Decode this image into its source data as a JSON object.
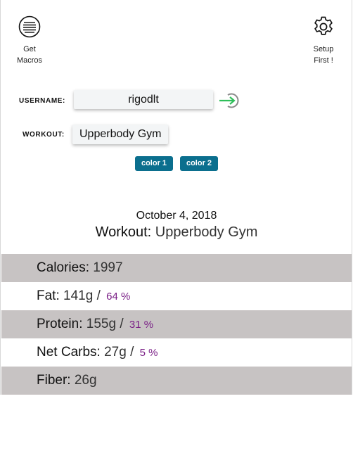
{
  "header": {
    "macros_label_line1": "Get",
    "macros_label_line2": "Macros",
    "setup_label_line1": "Setup",
    "setup_label_line2": "First !"
  },
  "form": {
    "username_label": "USERNAME:",
    "username_value": "rigodlt",
    "workout_label": "WORKOUT:",
    "workout_value": "Upperbody Gym",
    "color1_label": "color 1",
    "color2_label": "color 2"
  },
  "summary": {
    "date": "October 4, 2018",
    "workout_label": "Workout",
    "workout_value": "Upperbody Gym"
  },
  "macros": {
    "calories": {
      "label": "Calories:",
      "value": "1997"
    },
    "fat": {
      "label": "Fat:",
      "value": "141g",
      "percent": "64 %"
    },
    "protein": {
      "label": "Protein:",
      "value": "155g",
      "percent": "31 %"
    },
    "carbs": {
      "label": "Net Carbs:",
      "value": "27g",
      "percent": "5 %"
    },
    "fiber": {
      "label": "Fiber:",
      "value": "26g"
    }
  },
  "colors": {
    "button": "#0b6f8e",
    "row_shade": "#c7c3c3",
    "percent": "#7a1f86",
    "login_arrow": "#2fbf5a"
  }
}
